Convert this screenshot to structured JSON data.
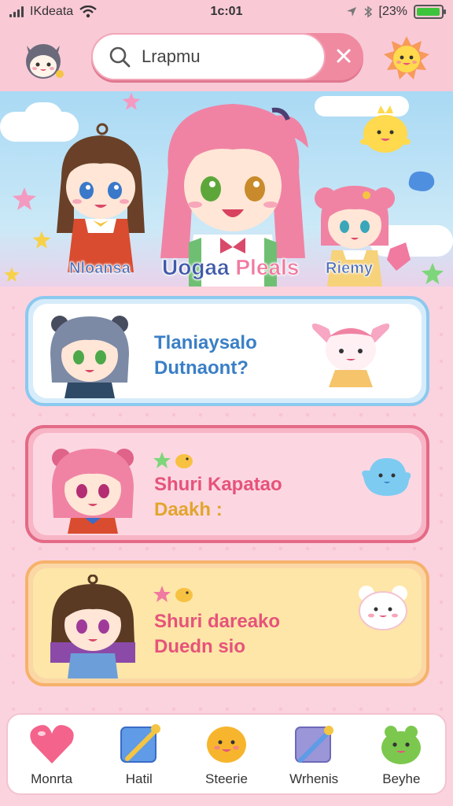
{
  "status_bar": {
    "carrier": "IKdeata",
    "time": "1c:01",
    "battery_text": "[23%",
    "battery_level": 0.95
  },
  "header": {
    "search": {
      "value": "Lrapmu",
      "placeholder": ""
    },
    "left_avatar": "cat-mascot-icon",
    "right_avatar": "sun-mascot-icon",
    "clear_icon": "close-icon"
  },
  "banner": {
    "left_name": "Nloansa",
    "center_name_a": "Uogaa",
    "center_name_b": "Pleals",
    "right_name": "Riemy"
  },
  "cards": [
    {
      "title": "Tlaniaysalo",
      "subtitle": "Dutnaont?",
      "border": "#8cc9ef",
      "bg": "#ffffff",
      "title_color": "#3a7fc6",
      "sub_color": "#3a7fc6"
    },
    {
      "title": "Shuri Kapatao",
      "subtitle": "Daakh :",
      "border": "#e46a86",
      "bg": "#fcd7e2",
      "title_color": "#e6537a",
      "sub_color": "#e2a52d"
    },
    {
      "title": "Shuri dareako",
      "subtitle": "Duedn sio",
      "border": "#f6b26b",
      "bg": "#fde6a8",
      "title_color": "#e6537a",
      "sub_color": "#e6537a"
    }
  ],
  "nav": [
    {
      "label": "Monrta",
      "icon": "heart-icon"
    },
    {
      "label": "Hatil",
      "icon": "wand-book-icon"
    },
    {
      "label": "Steerie",
      "icon": "smiley-blob-icon"
    },
    {
      "label": "Wrhenis",
      "icon": "wand-icon"
    },
    {
      "label": "Beyhe",
      "icon": "green-frog-icon"
    }
  ],
  "colors": {
    "accent": "#f08aa1",
    "background": "#fbd3df"
  }
}
